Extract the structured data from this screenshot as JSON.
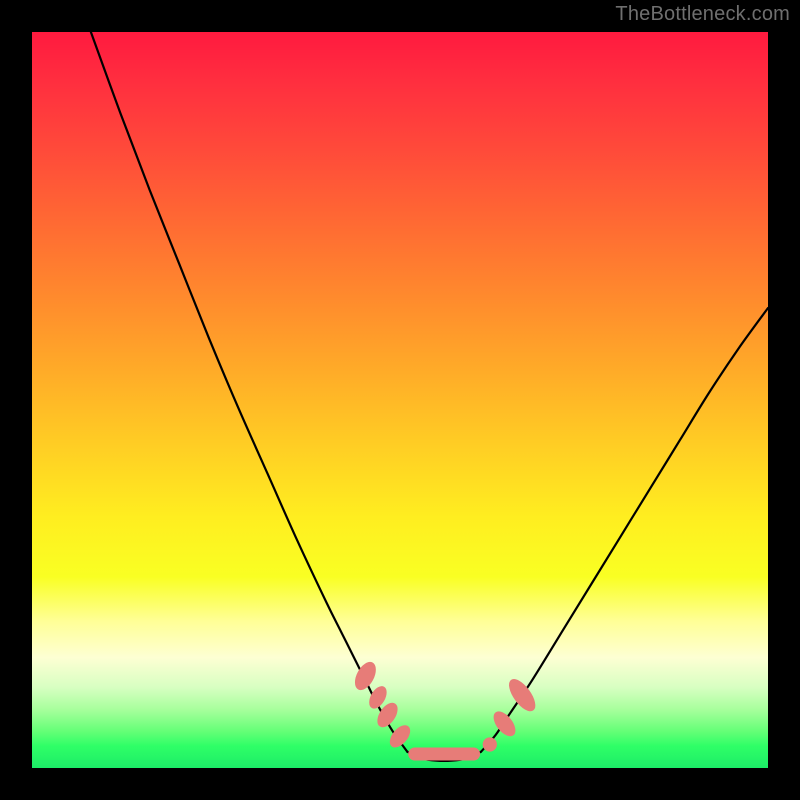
{
  "watermark": "TheBottleneck.com",
  "colors": {
    "frame": "#000000",
    "curve": "#000000",
    "marker": "#e77c78",
    "gradient_top": "#ff1a3f",
    "gradient_bottom": "#1cec67"
  },
  "chart_data": {
    "type": "line",
    "title": "",
    "xlabel": "",
    "ylabel": "",
    "xlim": [
      0,
      100
    ],
    "ylim": [
      0,
      100
    ],
    "series": [
      {
        "name": "left-curve",
        "x": [
          8,
          12,
          16,
          20,
          24,
          28,
          32,
          36,
          40,
          42,
          44,
          45.5,
          47,
          49,
          51
        ],
        "y": [
          100,
          89,
          78.5,
          68.5,
          58.5,
          49,
          40,
          31,
          22.5,
          18.5,
          14.5,
          11.5,
          8.5,
          5,
          2.2
        ]
      },
      {
        "name": "valley-floor",
        "x": [
          51,
          53,
          55,
          57,
          59,
          61
        ],
        "y": [
          2.2,
          1.3,
          1.0,
          1.0,
          1.3,
          2.2
        ]
      },
      {
        "name": "right-curve",
        "x": [
          61,
          63,
          65,
          68,
          72,
          76,
          80,
          84,
          88,
          92,
          96,
          100
        ],
        "y": [
          2.2,
          4.5,
          7.5,
          12,
          18.5,
          25,
          31.5,
          38,
          44.5,
          51,
          57,
          62.5
        ]
      }
    ],
    "markers": [
      {
        "shape": "ellipse",
        "cx": 45.3,
        "cy": 12.5,
        "rx": 1.1,
        "ry": 2.0,
        "rot": 28
      },
      {
        "shape": "ellipse",
        "cx": 47.0,
        "cy": 9.6,
        "rx": 0.9,
        "ry": 1.6,
        "rot": 30
      },
      {
        "shape": "ellipse",
        "cx": 48.3,
        "cy": 7.2,
        "rx": 1.0,
        "ry": 1.8,
        "rot": 34
      },
      {
        "shape": "ellipse",
        "cx": 50.0,
        "cy": 4.3,
        "rx": 0.95,
        "ry": 1.7,
        "rot": 40
      },
      {
        "shape": "capsule",
        "x1": 52.0,
        "y1": 1.9,
        "x2": 60.0,
        "y2": 1.9
      },
      {
        "shape": "circle",
        "cx": 62.2,
        "cy": 3.2,
        "r": 0.9
      },
      {
        "shape": "ellipse",
        "cx": 64.2,
        "cy": 6.0,
        "rx": 1.0,
        "ry": 1.9,
        "rot": -38
      },
      {
        "shape": "ellipse",
        "cx": 66.6,
        "cy": 9.9,
        "rx": 1.1,
        "ry": 2.5,
        "rot": -36
      }
    ]
  }
}
